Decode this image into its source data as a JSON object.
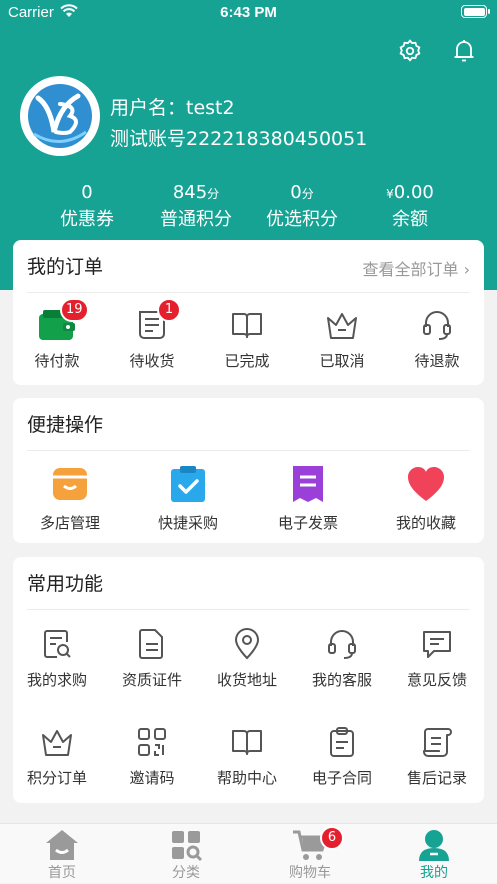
{
  "status_bar": {
    "carrier": "Carrier",
    "time": "6:43 PM"
  },
  "profile": {
    "username": "用户名：test2",
    "account": "测试账号222218380450051"
  },
  "stats": [
    {
      "value": "0",
      "unit": "",
      "label": "优惠券"
    },
    {
      "value": "845",
      "unit": "分",
      "label": "普通积分"
    },
    {
      "value": "0",
      "unit": "分",
      "label": "优选积分"
    },
    {
      "value": "0.00",
      "unit": "¥",
      "label": "余额"
    }
  ],
  "orders": {
    "title": "我的订单",
    "view_all": "查看全部订单",
    "items": [
      {
        "label": "待付款",
        "icon": "wallet-icon",
        "badge": "19"
      },
      {
        "label": "待收货",
        "icon": "receipt-icon",
        "badge": "1"
      },
      {
        "label": "已完成",
        "icon": "book-icon",
        "badge": ""
      },
      {
        "label": "已取消",
        "icon": "crown-icon",
        "badge": ""
      },
      {
        "label": "待退款",
        "icon": "headset-icon",
        "badge": ""
      }
    ]
  },
  "shortcuts": {
    "title": "便捷操作",
    "items": [
      {
        "label": "多店管理",
        "icon": "store-icon",
        "color": "#f5a13c"
      },
      {
        "label": "快捷采购",
        "icon": "clipboard-check-icon",
        "color": "#2aa8ec"
      },
      {
        "label": "电子发票",
        "icon": "invoice-icon",
        "color": "#9a3fd8"
      },
      {
        "label": "我的收藏",
        "icon": "heart-icon",
        "color": "#f0435a"
      }
    ]
  },
  "functions": {
    "title": "常用功能",
    "items": [
      {
        "label": "我的求购",
        "icon": "search-doc-icon"
      },
      {
        "label": "资质证件",
        "icon": "document-icon"
      },
      {
        "label": "收货地址",
        "icon": "location-icon"
      },
      {
        "label": "我的客服",
        "icon": "headset-icon"
      },
      {
        "label": "意见反馈",
        "icon": "message-icon"
      },
      {
        "label": "积分订单",
        "icon": "crown-icon"
      },
      {
        "label": "邀请码",
        "icon": "qr-code-icon"
      },
      {
        "label": "帮助中心",
        "icon": "book-icon"
      },
      {
        "label": "电子合同",
        "icon": "contract-icon"
      },
      {
        "label": "售后记录",
        "icon": "scroll-icon"
      }
    ]
  },
  "tabbar": [
    {
      "label": "首页",
      "icon": "home-icon",
      "badge": ""
    },
    {
      "label": "分类",
      "icon": "category-icon",
      "badge": ""
    },
    {
      "label": "购物车",
      "icon": "cart-icon",
      "badge": "6"
    },
    {
      "label": "我的",
      "icon": "user-icon",
      "badge": ""
    }
  ],
  "colors": {
    "brand": "#16a394",
    "badge": "#e5202e",
    "icon_gray": "#555555",
    "tab_gray": "#9a9a9a"
  }
}
